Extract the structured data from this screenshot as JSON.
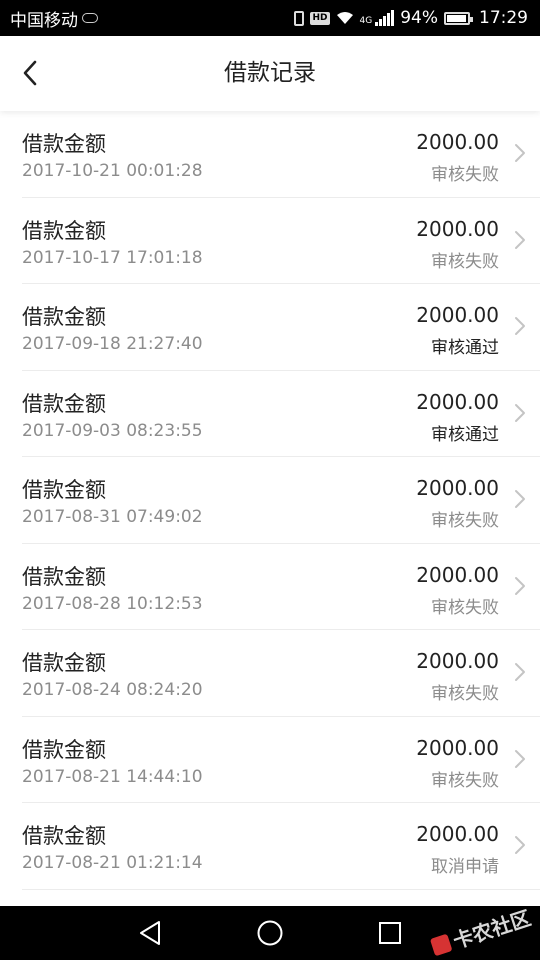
{
  "status_bar": {
    "carrier": "中国移动",
    "battery": "94%",
    "time": "17:29",
    "hd_label": "HD",
    "network_label": "4G"
  },
  "header": {
    "title": "借款记录"
  },
  "records": [
    {
      "title": "借款金额",
      "date": "2017-10-21 00:01:28",
      "amount": "2000.00",
      "status": "审核失败"
    },
    {
      "title": "借款金额",
      "date": "2017-10-17 17:01:18",
      "amount": "2000.00",
      "status": "审核失败"
    },
    {
      "title": "借款金额",
      "date": "2017-09-18 21:27:40",
      "amount": "2000.00",
      "status": "审核通过"
    },
    {
      "title": "借款金额",
      "date": "2017-09-03 08:23:55",
      "amount": "2000.00",
      "status": "审核通过"
    },
    {
      "title": "借款金额",
      "date": "2017-08-31 07:49:02",
      "amount": "2000.00",
      "status": "审核失败"
    },
    {
      "title": "借款金额",
      "date": "2017-08-28 10:12:53",
      "amount": "2000.00",
      "status": "审核失败"
    },
    {
      "title": "借款金额",
      "date": "2017-08-24 08:24:20",
      "amount": "2000.00",
      "status": "审核失败"
    },
    {
      "title": "借款金额",
      "date": "2017-08-21 14:44:10",
      "amount": "2000.00",
      "status": "审核失败"
    },
    {
      "title": "借款金额",
      "date": "2017-08-21 01:21:14",
      "amount": "2000.00",
      "status": "取消申请"
    }
  ],
  "watermark": "卡农社区",
  "colors": {
    "status_muted": "#8c8c8c",
    "status_approved": "#222222"
  }
}
